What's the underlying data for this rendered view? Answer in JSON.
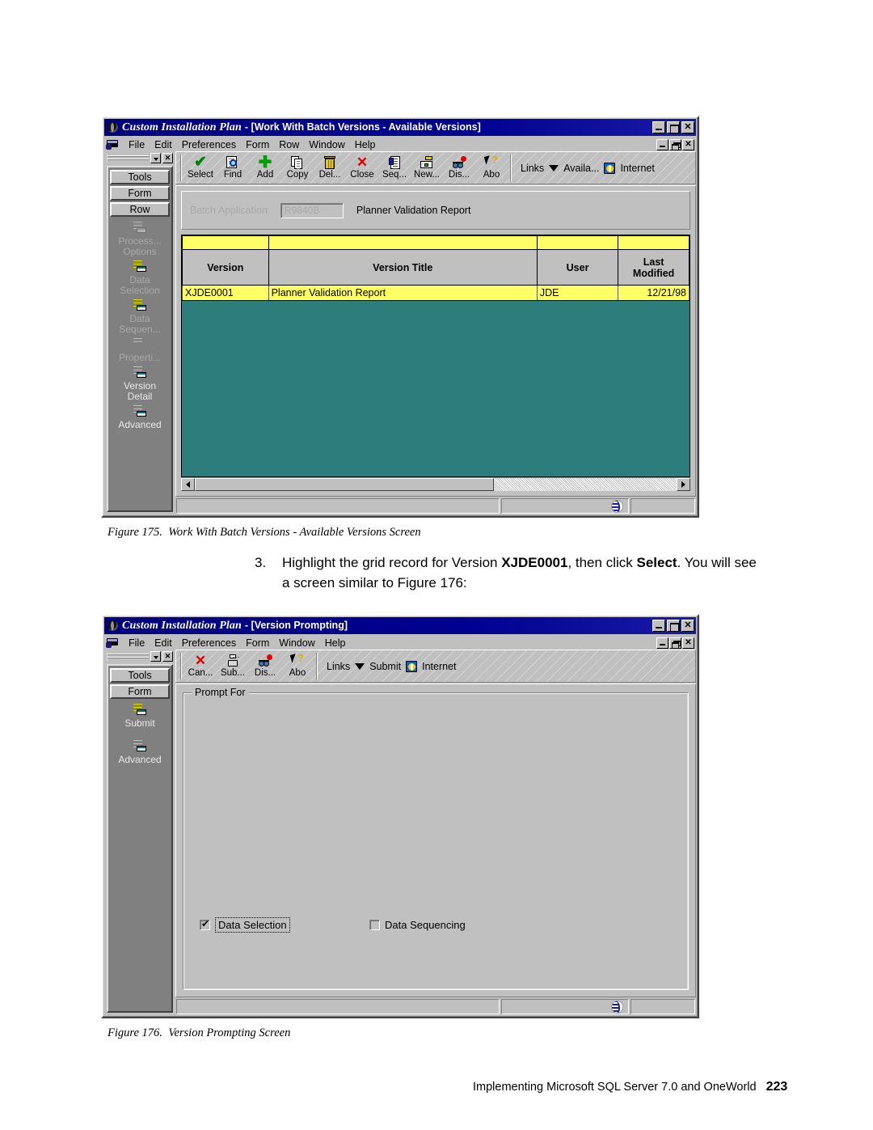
{
  "figure175": {
    "window": {
      "app_title": "Custom Installation Plan",
      "doc_title": "- [Work With Batch Versions - Available Versions]",
      "menus": [
        "File",
        "Edit",
        "Preferences",
        "Form",
        "Row",
        "Window",
        "Help"
      ],
      "toolbar": [
        {
          "label": "Select",
          "icon": "checkmark-icon"
        },
        {
          "label": "Find",
          "icon": "find-page-icon"
        },
        {
          "label": "Add",
          "icon": "plus-icon"
        },
        {
          "label": "Copy",
          "icon": "copy-pages-icon"
        },
        {
          "label": "Del...",
          "icon": "trash-icon"
        },
        {
          "label": "Close",
          "icon": "red-x-icon"
        },
        {
          "label": "Seq...",
          "icon": "sequence-icon"
        },
        {
          "label": "New...",
          "icon": "new-window-icon"
        },
        {
          "label": "Dis...",
          "icon": "binoculars-icon"
        },
        {
          "label": "Abo",
          "icon": "arrow-question-icon"
        }
      ],
      "links_label": "Links",
      "links_dropdown": "Availa...",
      "internet_label": "Internet",
      "exitbar": {
        "tabs": [
          "Tools",
          "Form",
          "Row"
        ],
        "items": [
          {
            "label_1": "Process...",
            "label_2": "Options",
            "state": "disabled"
          },
          {
            "label_1": "Data",
            "label_2": "Selection",
            "state": "disabled"
          },
          {
            "label_1": "Data",
            "label_2": "Sequen...",
            "state": "disabled"
          },
          {
            "label_1": "Properti...",
            "label_2": "",
            "state": "disabled"
          },
          {
            "label_1": "Version",
            "label_2": "Detail",
            "state": "enabled"
          },
          {
            "label_1": "Advanced",
            "label_2": "",
            "state": "enabled"
          }
        ]
      },
      "header": {
        "batch_application_label": "Batch Application",
        "batch_application_value": "R9840B",
        "batch_application_description": "Planner Validation Report"
      },
      "grid": {
        "columns": [
          "Version",
          "Version Title",
          "User",
          "Last\nModified"
        ],
        "column_header_version": "Version",
        "column_header_title": "Version Title",
        "column_header_user": "User",
        "column_header_modified_line1": "Last",
        "column_header_modified_line2": "Modified",
        "rows": [
          {
            "version": "XJDE0001",
            "title": "Planner Validation Report",
            "user": "JDE",
            "modified": "12/21/98"
          }
        ]
      }
    },
    "caption_prefix": "Figure 175.",
    "caption_text": "Work With Batch Versions - Available Versions Screen"
  },
  "step": {
    "number": "3.",
    "text_1": "Highlight the grid record for Version ",
    "bold_1": "XJDE0001",
    "text_2": ", then click ",
    "bold_2": "Select",
    "text_3": ". You will see",
    "line2": "a screen similar to Figure 176:"
  },
  "figure176": {
    "window": {
      "app_title": "Custom Installation Plan",
      "doc_title": "- [Version Prompting]",
      "menus": [
        "File",
        "Edit",
        "Preferences",
        "Form",
        "Window",
        "Help"
      ],
      "toolbar": [
        {
          "label": "Can...",
          "icon": "red-x-icon"
        },
        {
          "label": "Sub...",
          "icon": "printer-icon"
        },
        {
          "label": "Dis...",
          "icon": "binoculars-icon"
        },
        {
          "label": "Abo",
          "icon": "arrow-question-icon"
        }
      ],
      "links_label": "Links",
      "links_dropdown": "Submit",
      "internet_label": "Internet",
      "exitbar": {
        "tabs": [
          "Tools",
          "Form"
        ],
        "items": [
          {
            "label_1": "Submit",
            "label_2": "",
            "state": "enabled"
          },
          {
            "label_1": "Advanced",
            "label_2": "",
            "state": "enabled"
          }
        ]
      },
      "groupbox": {
        "legend": "Prompt For",
        "checkboxes": [
          {
            "label": "Data Selection",
            "checked": "true",
            "focused": "true"
          },
          {
            "label": "Data Sequencing",
            "checked": "false",
            "focused": "false"
          }
        ]
      }
    },
    "caption_prefix": "Figure 176.",
    "caption_text": "Version Prompting Screen"
  },
  "footer": {
    "text": "Implementing Microsoft SQL Server 7.0 and OneWorld",
    "page": "223"
  },
  "colors": {
    "titlebar": "#00007e",
    "grid_background": "#2e7d7d",
    "row_highlight": "#ffff66",
    "chrome": "#c0c0c0",
    "exitbar": "#808080"
  }
}
